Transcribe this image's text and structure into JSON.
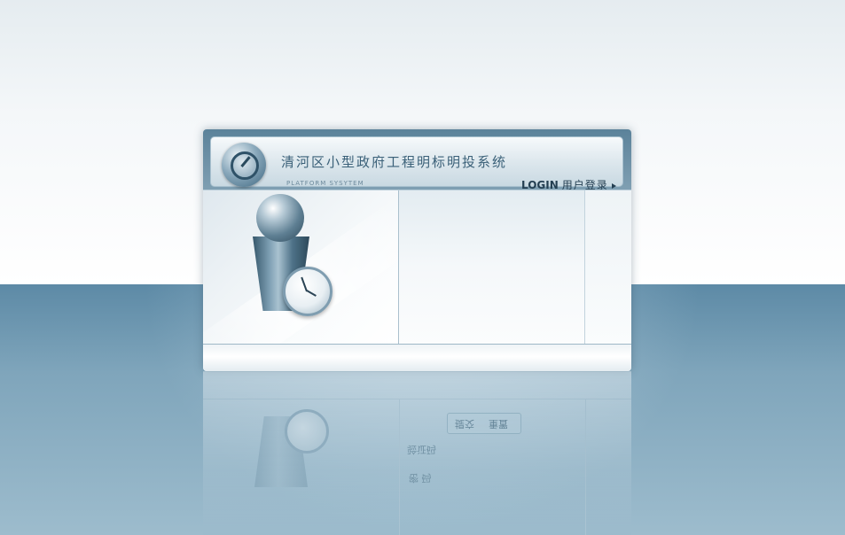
{
  "app": {
    "title": "清河区小型政府工程明标明投系统",
    "subtitle": "PLATFORM SYSYTEM"
  },
  "header": {
    "login_en": "LOGIN",
    "login_zh": "用户登录",
    "logo_icon": "clock-logo-icon",
    "arrow_icon": "triangle-right-icon"
  },
  "reflection": {
    "btn_submit": "提交",
    "btn_reset": "重置",
    "text_1": "验证码",
    "text_2": "密 码"
  },
  "colors": {
    "header_bg": "#5b829a",
    "title_text": "#3a6078",
    "floor": "#5d8aa6",
    "login_text": "#243f52"
  }
}
